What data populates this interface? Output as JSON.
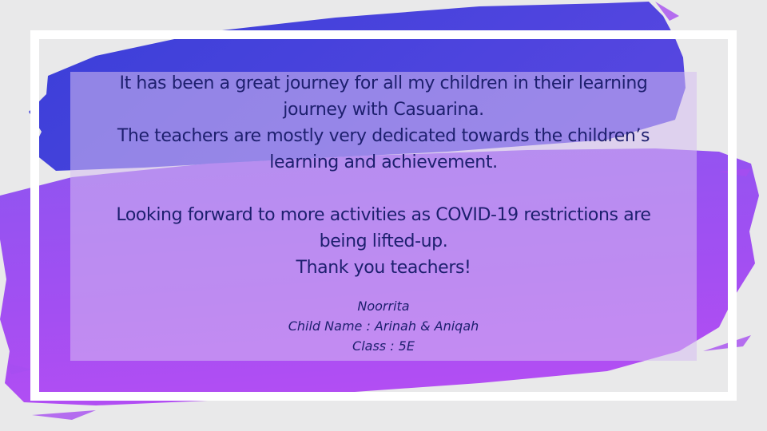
{
  "testimonial": {
    "lines": [
      "It has been a great journey for all my children in their learning",
      "journey with Casuarina.",
      "The teachers are mostly very dedicated towards the children’s",
      "learning and achievement.",
      "Looking forward to more activities as COVID-19 restrictions are",
      "being lifted-up.",
      "Thank you teachers!"
    ],
    "signature": {
      "parent": "Noorrita",
      "child": "Child Name : Arinah & Aniqah",
      "class": "Class : 5E"
    }
  },
  "colors": {
    "background": "#e9e9ea",
    "frame": "#ffffff",
    "brush_blue": "#3b3fd4",
    "brush_purple": "#a64df0",
    "text": "#1d1f6e"
  }
}
